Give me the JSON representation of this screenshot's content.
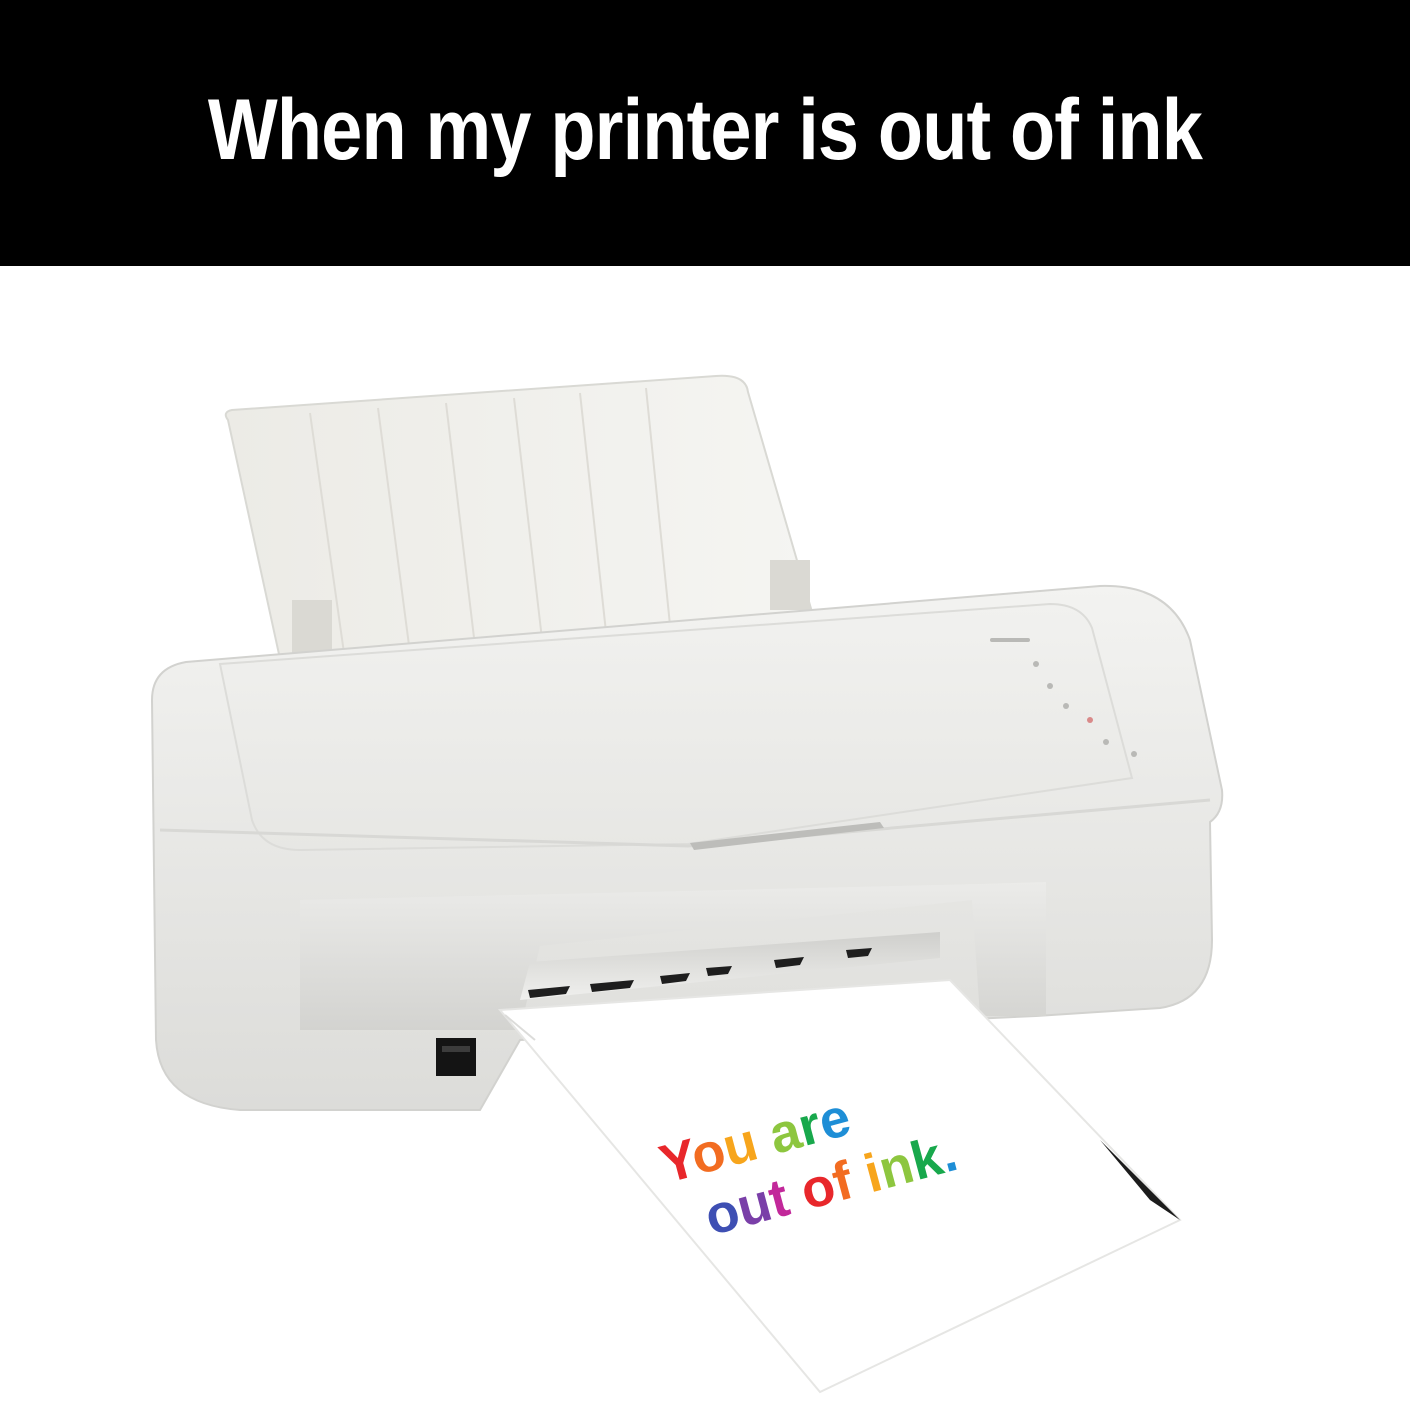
{
  "caption": {
    "text": "When my printer is out of ink",
    "background_color": "#000000",
    "text_color": "#ffffff"
  },
  "printout": {
    "line1": [
      "Y",
      "o",
      "u",
      " ",
      "a",
      "r",
      "e"
    ],
    "line2": [
      "o",
      "u",
      "t",
      " ",
      "o",
      "f",
      " ",
      "i",
      "n",
      "k",
      "."
    ],
    "letter_colors": [
      "#e8272b",
      "#f26c21",
      "#f7a51c",
      "#8dc63f",
      "#18a84c",
      "#1e8ed6",
      "#3e4fb3",
      "#7a3fa8",
      "#c2289a"
    ]
  },
  "printer": {
    "body_color": "#eeeeec",
    "shadow_color": "#d6d6d3"
  }
}
